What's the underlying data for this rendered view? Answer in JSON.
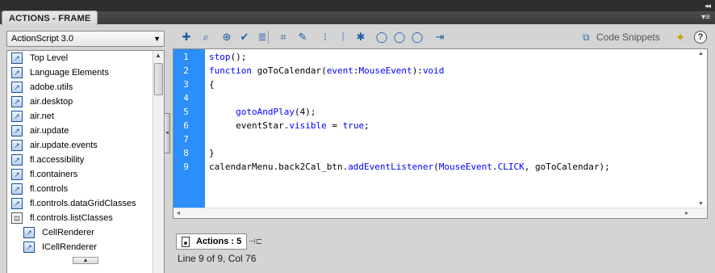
{
  "panel": {
    "title": "ACTIONS - FRAME",
    "collapse_glyph": "◂◂",
    "menu_glyph": "▾≡"
  },
  "sidebar": {
    "language_select": "ActionScript 3.0",
    "items": [
      {
        "label": "Top Level",
        "level": 0,
        "icon": "package-icon"
      },
      {
        "label": "Language Elements",
        "level": 0,
        "icon": "package-icon"
      },
      {
        "label": "adobe.utils",
        "level": 0,
        "icon": "package-icon"
      },
      {
        "label": "air.desktop",
        "level": 0,
        "icon": "package-icon"
      },
      {
        "label": "air.net",
        "level": 0,
        "icon": "package-icon"
      },
      {
        "label": "air.update",
        "level": 0,
        "icon": "package-icon"
      },
      {
        "label": "air.update.events",
        "level": 0,
        "icon": "package-icon"
      },
      {
        "label": "fl.accessibility",
        "level": 0,
        "icon": "package-icon"
      },
      {
        "label": "fl.containers",
        "level": 0,
        "icon": "package-icon"
      },
      {
        "label": "fl.controls",
        "level": 0,
        "icon": "package-icon"
      },
      {
        "label": "fl.controls.dataGridClasses",
        "level": 0,
        "icon": "package-icon"
      },
      {
        "label": "fl.controls.listClasses",
        "level": 0,
        "icon": "open-package-icon"
      },
      {
        "label": "CellRenderer",
        "level": 1,
        "icon": "class-icon"
      },
      {
        "label": "ICellRenderer",
        "level": 1,
        "icon": "class-icon"
      }
    ]
  },
  "toolbar": {
    "buttons": [
      {
        "name": "add-script-item-button",
        "glyph": "✚"
      },
      {
        "name": "find-button",
        "glyph": "⌕"
      },
      {
        "name": "insert-target-path-button",
        "glyph": "⊕"
      },
      {
        "name": "check-syntax-button",
        "glyph": "✔"
      },
      {
        "name": "auto-format-button",
        "glyph": "≣"
      },
      {
        "name": "show-code-hint-button",
        "glyph": "⌗"
      },
      {
        "name": "debug-options-button",
        "glyph": "✎"
      },
      {
        "name": "collapse-between-braces-button",
        "glyph": "⁝"
      },
      {
        "name": "collapse-selection-button",
        "glyph": "⁞"
      },
      {
        "name": "expand-all-button",
        "glyph": "✱"
      },
      {
        "name": "apply-block-comment-button",
        "glyph": "◯"
      },
      {
        "name": "apply-line-comment-button",
        "glyph": "◯"
      },
      {
        "name": "remove-comment-button",
        "glyph": "◯"
      },
      {
        "name": "show-hide-toolbox-button",
        "glyph": "⇥"
      }
    ],
    "code_snippets_label": "Code Snippets",
    "help_label": "?"
  },
  "editor": {
    "lines": [
      {
        "no": "1",
        "code": "stop();"
      },
      {
        "no": "2",
        "code": "function goToCalendar(event:MouseEvent):void"
      },
      {
        "no": "3",
        "code": "{"
      },
      {
        "no": "4",
        "code": ""
      },
      {
        "no": "5",
        "code": "     gotoAndPlay(4);"
      },
      {
        "no": "6",
        "code": "     eventStar.visible = true;"
      },
      {
        "no": "7",
        "code": ""
      },
      {
        "no": "8",
        "code": "}"
      },
      {
        "no": "9",
        "code": "calendarMenu.back2Cal_btn.addEventListener(MouseEvent.CLICK, goToCalendar);"
      }
    ]
  },
  "bottom": {
    "script_tab_label": "Actions : 5",
    "status_text": "Line 9 of 9, Col 76"
  },
  "colors": {
    "gutter": "#2c8ef8",
    "keyword": "#0000ff"
  }
}
